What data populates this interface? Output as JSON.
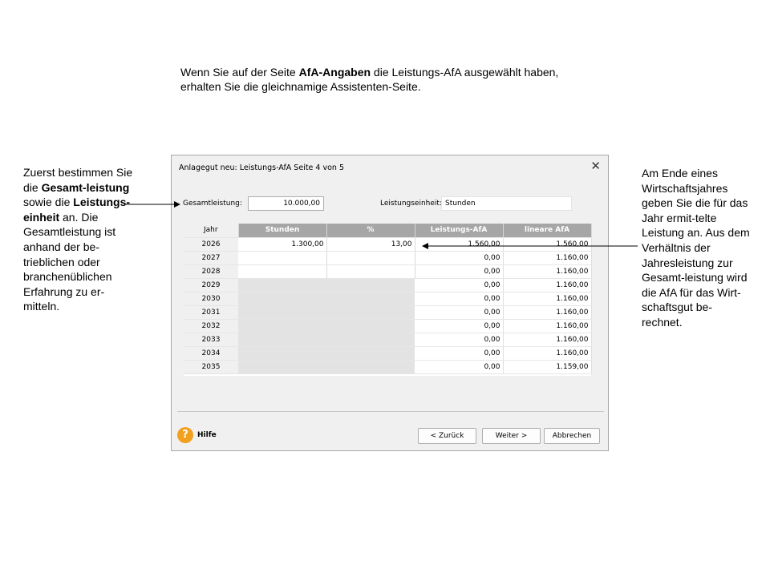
{
  "intro": {
    "t1": "Wenn Sie auf der Seite ",
    "bold": "AfA-Angaben",
    "t2": " die Leistungs-AfA ausgewählt haben,",
    "line2": "erhalten Sie die gleichnamige Assistenten-Seite."
  },
  "note_left": {
    "p1": "Zuerst bestimmen Sie die ",
    "b1": "Gesamt-leistung",
    "p2": " sowie die ",
    "b2": "Leistungs-einheit",
    "p3": " an. Die Gesamtleistung ist anhand der be-trieblichen oder branchenüblichen Erfahrung zu er-mitteln."
  },
  "note_right": "Am Ende eines Wirtschaftsjahres geben Sie die für das Jahr ermit-telte Leistung an. Aus dem Verhältnis der Jahresleistung zur Gesamt-leistung wird die AfA für das Wirt-schaftsgut be-rechnet.",
  "dialog": {
    "title": "Anlagegut neu: Leistungs-AfA Seite 4 von 5",
    "close": "✕",
    "gesamt_label": "Gesamtleistung:",
    "gesamt_value": "10.000,00",
    "einheit_label": "Leistungseinheit:",
    "einheit_value": "Stunden",
    "columns": [
      "Jahr",
      "Stunden",
      "%",
      "Leistungs-AfA",
      "lineare AfA"
    ],
    "rows": [
      {
        "jahr": "2026",
        "stunden": "1.300,00",
        "pct": "13,00",
        "leistung": "1.560,00",
        "linear": "1.560,00"
      },
      {
        "jahr": "2027",
        "stunden": "",
        "pct": "",
        "leistung": "0,00",
        "linear": "1.160,00"
      },
      {
        "jahr": "2028",
        "stunden": "",
        "pct": "",
        "leistung": "0,00",
        "linear": "1.160,00"
      },
      {
        "jahr": "2029",
        "stunden": "",
        "pct": "",
        "leistung": "0,00",
        "linear": "1.160,00"
      },
      {
        "jahr": "2030",
        "stunden": "",
        "pct": "",
        "leistung": "0,00",
        "linear": "1.160,00"
      },
      {
        "jahr": "2031",
        "stunden": "",
        "pct": "",
        "leistung": "0,00",
        "linear": "1.160,00"
      },
      {
        "jahr": "2032",
        "stunden": "",
        "pct": "",
        "leistung": "0,00",
        "linear": "1.160,00"
      },
      {
        "jahr": "2033",
        "stunden": "",
        "pct": "",
        "leistung": "0,00",
        "linear": "1.160,00"
      },
      {
        "jahr": "2034",
        "stunden": "",
        "pct": "",
        "leistung": "0,00",
        "linear": "1.160,00"
      },
      {
        "jahr": "2035",
        "stunden": "",
        "pct": "",
        "leistung": "0,00",
        "linear": "1.159,00"
      }
    ],
    "help_icon": "?",
    "help_label": "Hilfe",
    "back": "< Zurück",
    "next": "Weiter >",
    "cancel": "Abbrechen"
  }
}
